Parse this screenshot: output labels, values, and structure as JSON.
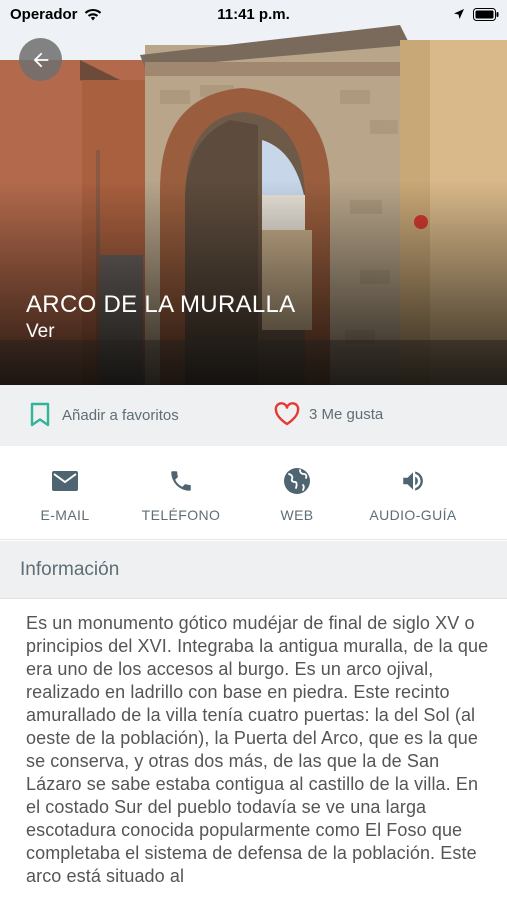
{
  "status_bar": {
    "carrier": "Operador",
    "time": "11:41 p.m."
  },
  "hero": {
    "title": "ARCO DE LA MURALLA",
    "subtitle": "Ver"
  },
  "actions": {
    "favorite_label": "Añadir a favoritos",
    "like_label": "3 Me gusta",
    "icon_color": "#34b39a",
    "like_color": "#e53935"
  },
  "contact": [
    {
      "label": "E-MAIL",
      "icon": "mail-icon"
    },
    {
      "label": "TELÉFONO",
      "icon": "phone-icon"
    },
    {
      "label": "WEB",
      "icon": "globe-icon"
    },
    {
      "label": "AUDIO-GUÍA",
      "icon": "speaker-icon"
    }
  ],
  "info": {
    "title": "Información",
    "text": "Es un monumento gótico mudéjar de final de siglo XV o principios del XVI. Integraba la antigua muralla, de la que era uno de los accesos al burgo. Es un arco ojival, realizado en ladrillo con base en piedra. Este recinto amurallado de la villa tenía cuatro puertas: la del Sol (al oeste de la población), la Puerta del Arco, que es la que se conserva, y otras dos más, de las que la de San Lázaro se sabe estaba contigua al castillo de la villa. En el costado Sur del pueblo todavía se ve una larga escotadura conocida popularmente como El Foso que completaba el sistema de defensa de la población. Este arco está situado al"
  },
  "colors": {
    "accent": "#34b39a",
    "muted_text": "#5f6e76",
    "contact_icon": "#4e6470",
    "section_bg": "#eef0f1"
  }
}
